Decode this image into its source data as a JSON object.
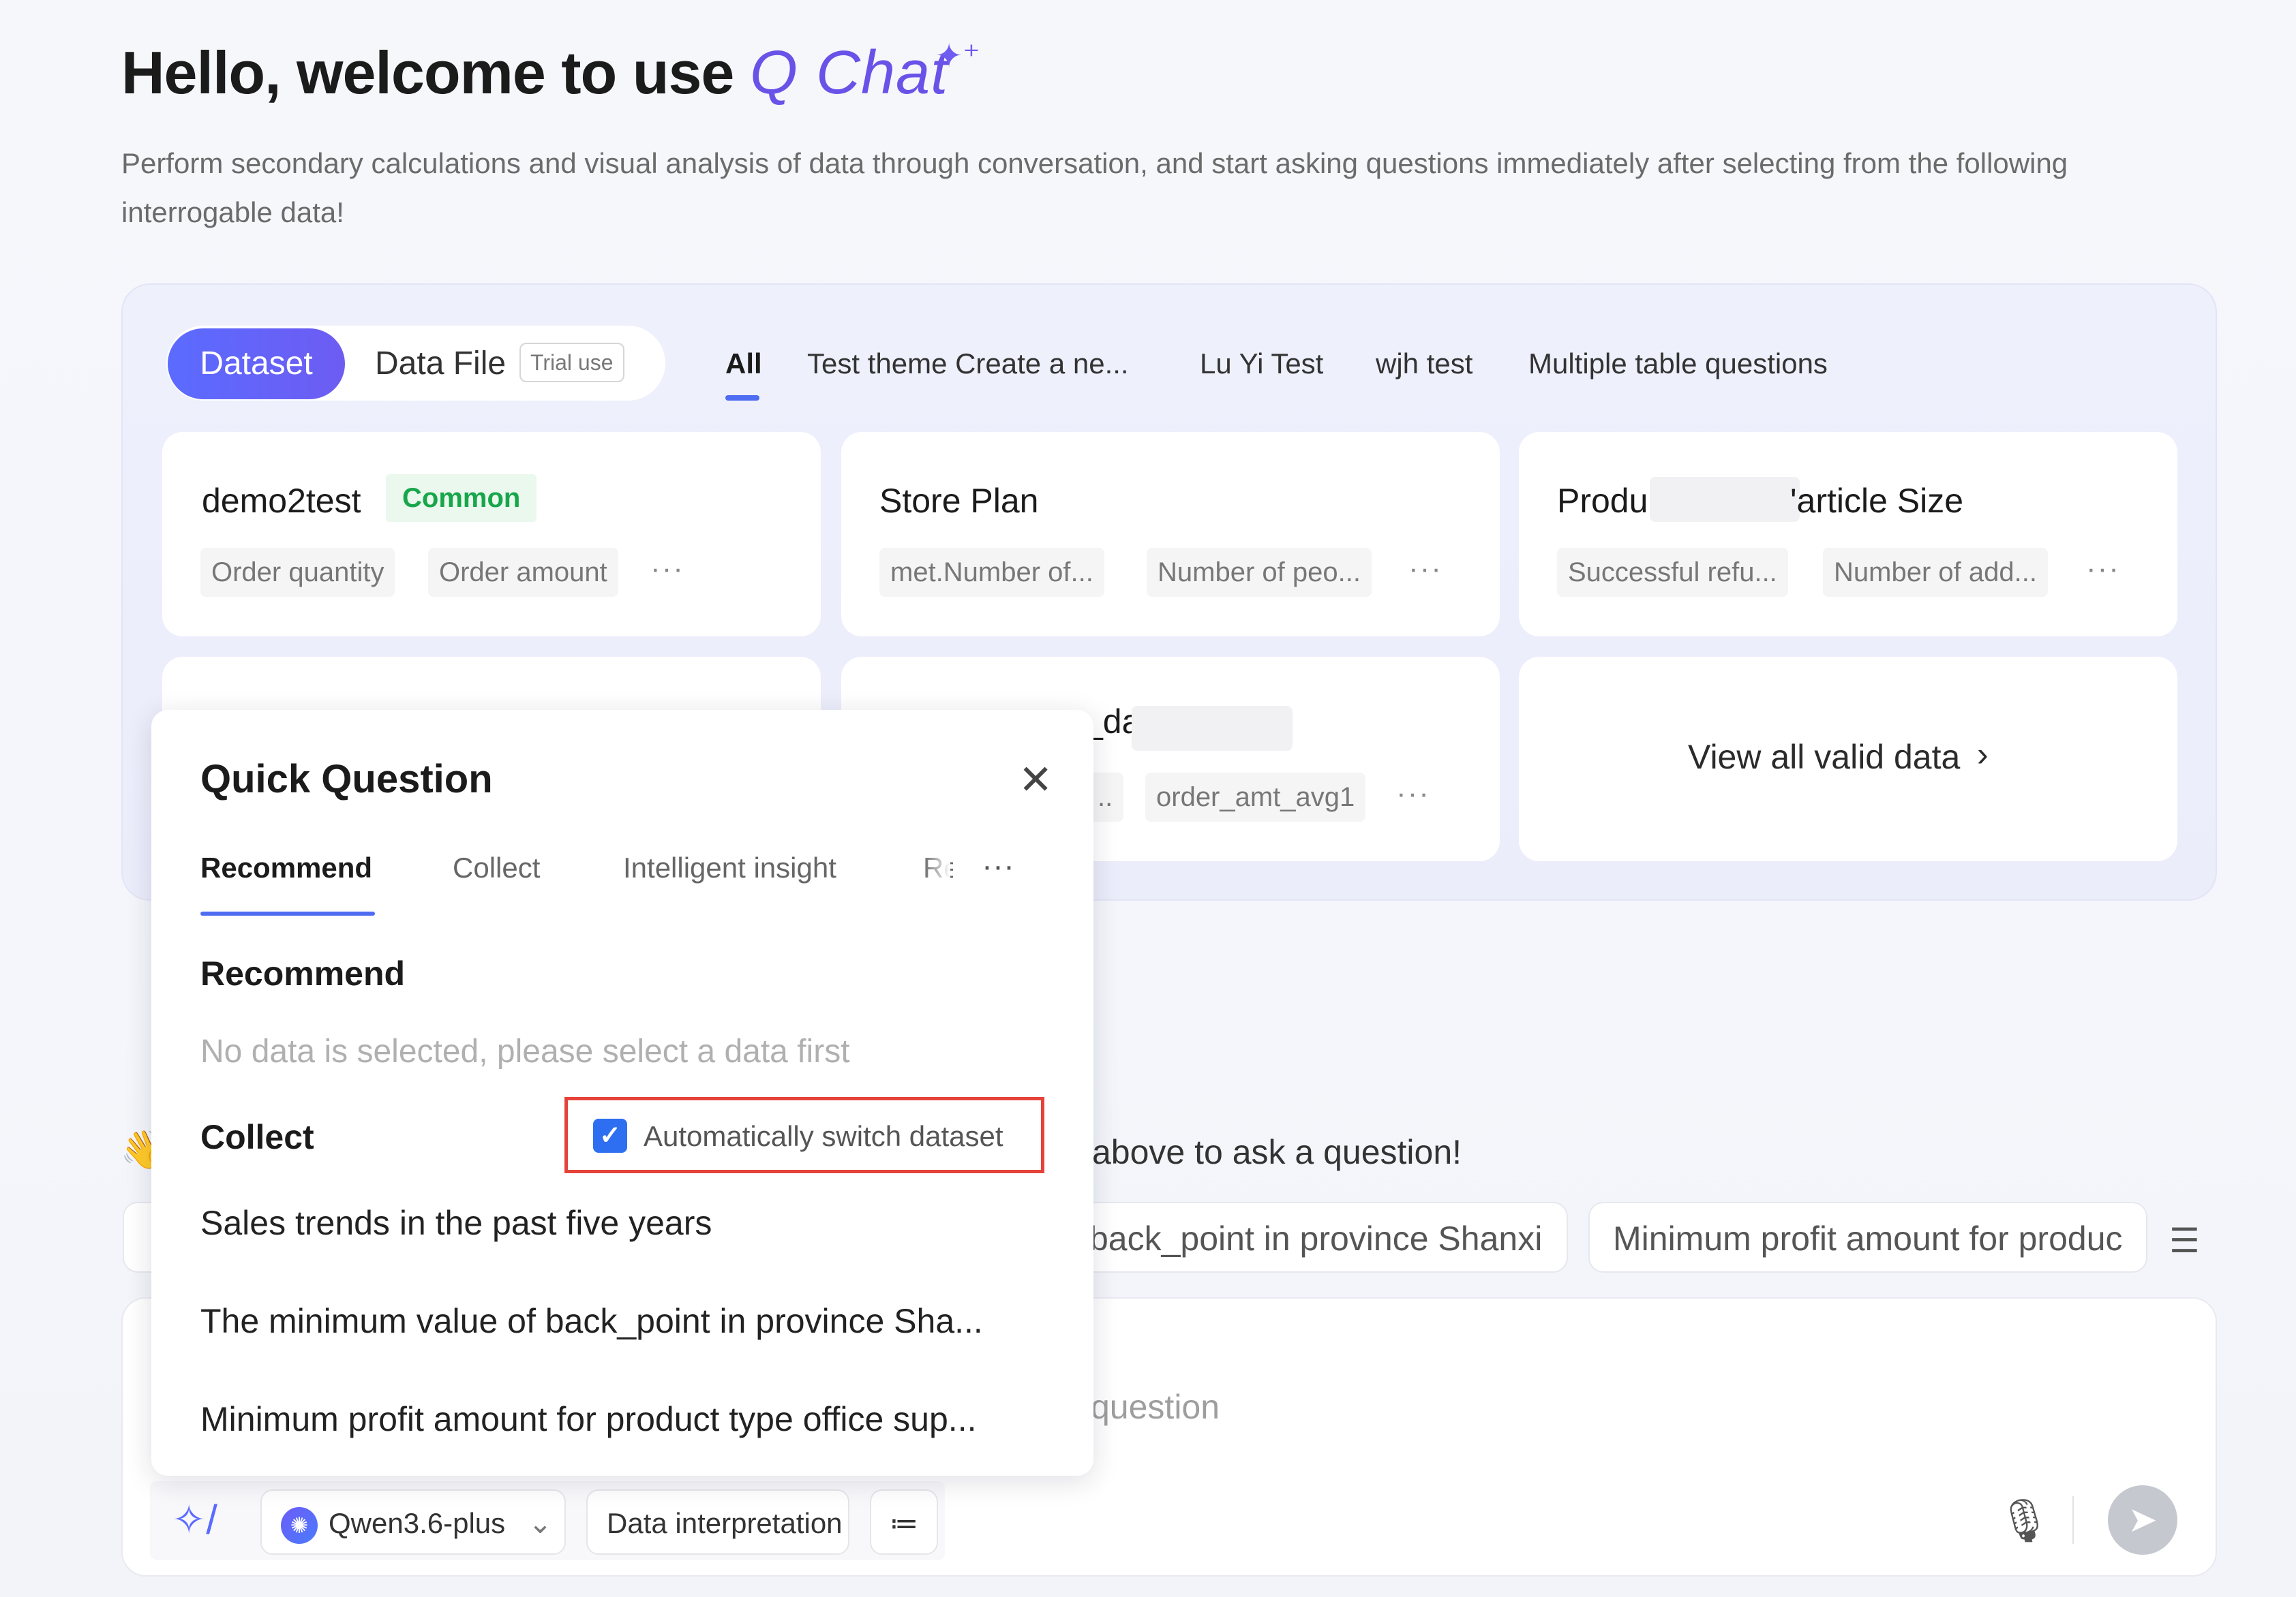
{
  "header": {
    "greeting": "Hello, welcome to use",
    "brand": "Q Chat",
    "sparkle_icon": "sparkle-icon",
    "subtitle": "Perform secondary calculations and visual analysis of data through conversation, and start asking questions immediately after selecting from the following interrogable data!"
  },
  "data_panel": {
    "segment": {
      "active": "Dataset",
      "other": "Data File",
      "trial_badge": "Trial use"
    },
    "filter_tabs": [
      "All",
      "Test theme Create a ne...",
      "Lu Yi Test",
      "wjh test",
      "Multiple table questions"
    ],
    "active_filter": "All",
    "cards": [
      {
        "title": "demo2test",
        "badge": "Common",
        "tags": [
          "Order quantity",
          "Order amount"
        ],
        "more": "···"
      },
      {
        "title": "Store Plan",
        "tags": [
          "met.Number of...",
          "Number of peo..."
        ],
        "more": "···"
      },
      {
        "title_start": "Produ",
        "title_end": "'article Size",
        "tags": [
          "Successful refu...",
          "Number of add..."
        ],
        "more": "···"
      },
      {
        "title_fragment": "_da",
        "tags": [
          "..",
          "order_amt_avg1"
        ],
        "more": "···"
      }
    ],
    "view_all": "View all valid data",
    "view_all_icon": "chevron-right-icon"
  },
  "below": {
    "hint_text": "above to ask a question!",
    "wave_icon": "waving-hand-icon",
    "chips": [
      "back_point in province Shanxi",
      "Minimum profit amount for produc"
    ],
    "list_icon": "list-icon",
    "input_placeholder": "question"
  },
  "toolbar": {
    "magic_icon": "magic-wand-icon",
    "model": "Qwen3.6-plus",
    "model_icon": "qwen-logo-icon",
    "chevron_icon": "chevron-down-icon",
    "data_interpretation": "Data interpretation",
    "steps_icon": "steps-list-icon",
    "mic_icon": "microphone-icon",
    "send_icon": "send-icon"
  },
  "quick_question": {
    "title": "Quick Question",
    "close_icon": "close-icon",
    "tabs": [
      "Recommend",
      "Collect",
      "Intelligent insight",
      "Re"
    ],
    "active_tab": "Recommend",
    "more": "···",
    "recommend_title": "Recommend",
    "recommend_empty": "No data is selected, please select a data first",
    "collect_title": "Collect",
    "auto_switch_label": "Automatically switch dataset",
    "auto_switch_checked": true,
    "collect_items": [
      "Sales trends in the past five years",
      "The minimum value of back_point in province Sha...",
      "Minimum profit amount for product type office sup..."
    ]
  },
  "colors": {
    "accent": "#5b6bff",
    "brand_purple": "#6a52e8",
    "common_green": "#18a64b",
    "highlight_red": "#e5433a",
    "checkbox_blue": "#2e6ff2"
  }
}
